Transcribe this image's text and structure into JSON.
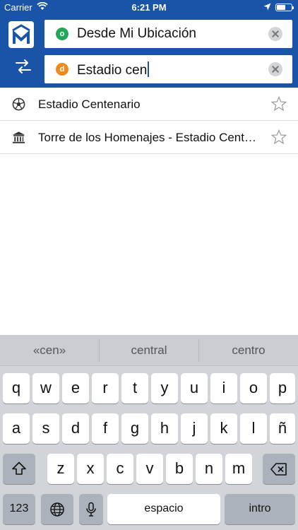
{
  "status": {
    "carrier": "Carrier",
    "time": "6:21 PM"
  },
  "search": {
    "origin": {
      "badge": "o",
      "value": "Desde Mi Ubicación"
    },
    "destination": {
      "badge": "d",
      "value": "Estadio cen"
    }
  },
  "results": [
    {
      "label": "Estadio Centenario",
      "icon": "soccer-ball-icon",
      "favorite": false
    },
    {
      "label": "Torre de los Homenajes - Estadio Centenario",
      "icon": "landmark-icon",
      "favorite": false
    }
  ],
  "keyboard": {
    "suggestions": [
      "«cen»",
      "central",
      "centro"
    ],
    "row1": [
      "q",
      "w",
      "e",
      "r",
      "t",
      "y",
      "u",
      "i",
      "o",
      "p"
    ],
    "row2": [
      "a",
      "s",
      "d",
      "f",
      "g",
      "h",
      "j",
      "k",
      "l",
      "ñ"
    ],
    "row3": [
      "z",
      "x",
      "c",
      "v",
      "b",
      "n",
      "m"
    ],
    "numbers_label": "123",
    "space_label": "espacio",
    "return_label": "intro"
  },
  "colors": {
    "header": "#1a54a9",
    "origin_badge": "#23a55a",
    "destination_badge": "#f18a1c"
  }
}
